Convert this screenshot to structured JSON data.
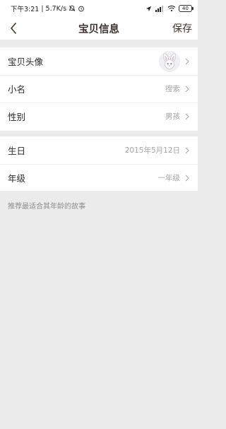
{
  "status_bar": {
    "time": "下午3:21",
    "speed": "5.7K/s",
    "network": "4G",
    "battery": "40"
  },
  "nav": {
    "title": "宝贝信息",
    "save_label": "保存"
  },
  "group_basic": [
    {
      "label": "宝贝头像",
      "value": ""
    },
    {
      "label": "小名",
      "value": "搜索"
    },
    {
      "label": "性别",
      "value": "男孩"
    }
  ],
  "group_detail": [
    {
      "label": "生日",
      "value": "2015年5月12日"
    },
    {
      "label": "年级",
      "value": "一年级"
    }
  ],
  "hint": "推荐最适合其年龄的故事"
}
